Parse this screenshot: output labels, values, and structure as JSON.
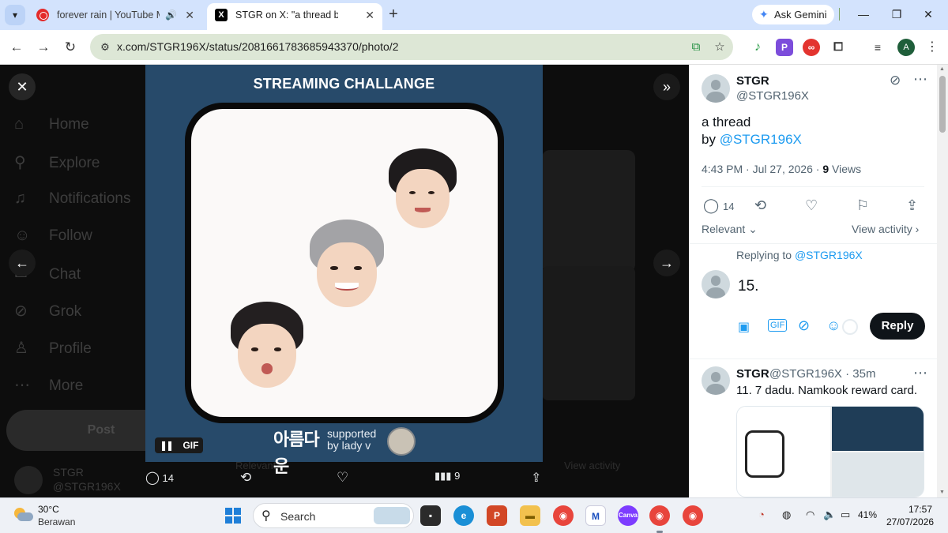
{
  "browser": {
    "tabs": [
      {
        "title": "forever rain | YouTube Musi",
        "extra": "🔊"
      },
      {
        "title": "STGR on X: \"a thread by @STGR"
      }
    ],
    "ask_gemini": "Ask Gemini",
    "url": "x.com/STGR196X/status/2081661783685943370/photo/2",
    "profile_initial": "A"
  },
  "x_nav": {
    "items": [
      {
        "label": "Home",
        "icon": "home-icon"
      },
      {
        "label": "Explore",
        "icon": "search-icon"
      },
      {
        "label": "Notifications",
        "icon": "bell-icon"
      },
      {
        "label": "Follow",
        "icon": "person-plus-icon"
      },
      {
        "label": "Chat",
        "icon": "chat-icon"
      },
      {
        "label": "Grok",
        "icon": "grok-icon"
      },
      {
        "label": "Profile",
        "icon": "person-icon"
      },
      {
        "label": "More",
        "icon": "more-icon"
      }
    ],
    "post_label": "Post",
    "user_name": "STGR",
    "user_handle": "@STGR196X"
  },
  "media": {
    "title": "STREAMING CHALLANGE",
    "gif_label": "GIF",
    "sponsor_logo": "아름다운",
    "sponsor_text_line1": "supported",
    "sponsor_text_line2": "by lady v"
  },
  "media_actions": {
    "replies": "14",
    "views": "9"
  },
  "background_ghost": {
    "relevant": "Relevant",
    "view_activity": "View activity"
  },
  "tweet": {
    "name": "STGR",
    "handle": "@STGR196X",
    "text_line1": "a thread",
    "text_by": "by ",
    "text_mention": "@STGR196X",
    "time": "4:43 PM · Jul 27, 2026 · ",
    "views_count": "9",
    "views_label": " Views",
    "reply_count": "14",
    "relevant": "Relevant",
    "view_activity": "View activity",
    "replying_to_prefix": "Replying to ",
    "replying_to": "@STGR196X",
    "draft_text": "15.",
    "reply_button": "Reply"
  },
  "reply_tweet": {
    "name": "STGR",
    "handle": "@STGR196X · 35m",
    "text": "11. 7 dadu. Namkook reward card."
  },
  "taskbar": {
    "temp": "30°C",
    "weather": "Berawan",
    "search_label": "Search",
    "battery": "41%",
    "time": "17:57",
    "date": "27/07/2026"
  }
}
